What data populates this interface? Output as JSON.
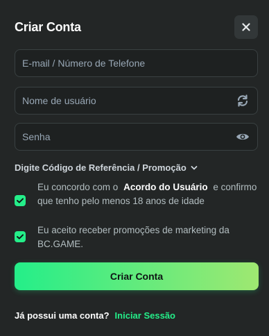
{
  "header": {
    "title": "Criar Conta"
  },
  "fields": {
    "email": {
      "placeholder": "E-mail / Número de Telefone",
      "value": ""
    },
    "username": {
      "placeholder": "Nome de usuário",
      "value": ""
    },
    "password": {
      "placeholder": "Senha",
      "value": ""
    }
  },
  "referral": {
    "label": "Digite Código de Referência / Promoção"
  },
  "agreements": {
    "terms": {
      "text_before": "Eu concordo com o",
      "link": "Acordo do Usuário",
      "text_after": "e confirmo que tenho pelo menos 18 anos de idade",
      "checked": true
    },
    "marketing": {
      "text": "Eu aceito receber promoções de marketing da BC.GAME.",
      "checked": true
    }
  },
  "submit": {
    "label": "Criar Conta"
  },
  "footer": {
    "question": "Já possui uma conta?",
    "login_link": "Iniciar Sessão"
  },
  "colors": {
    "accent": "#24ee89",
    "accent_end": "#9fe871",
    "background": "#232626",
    "input_bg": "#1e2121"
  },
  "icons": {
    "close": "close-icon",
    "refresh": "refresh-icon",
    "eye": "eye-icon",
    "chevron": "chevron-down-icon",
    "check": "check-icon"
  }
}
